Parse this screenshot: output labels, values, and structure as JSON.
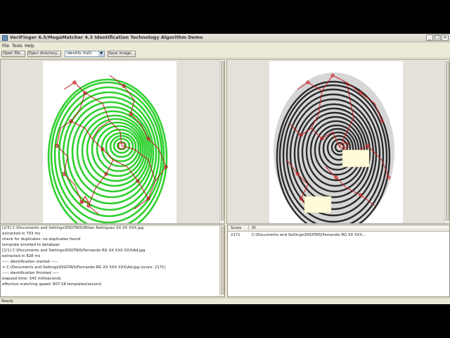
{
  "window": {
    "title": "VeriFinger 6.5/MegaMatcher 4.3 Identification Technology Algorithm Demo",
    "minimize": "_",
    "maximize": "□",
    "close": "×"
  },
  "menu": [
    "File",
    "Tools",
    "Help"
  ],
  "toolbar": {
    "open_file": "Open file...",
    "open_directory": "Open directory...",
    "mode_value": "Identify (full)",
    "save_image": "Save image..."
  },
  "log": {
    "lines": [
      "[2/5] C:\\Documents and Settings\\DIGITAIS\\Wilian Rodrigues XX XX XXX.jpg",
      "extracted in 703 ms",
      "check for duplicates: no duplicates found",
      "template enrolled to database",
      "[1/1] C:\\Documents and Settings\\DIGITAIS\\Fernando RG XX XXX XXX\\Ad.jpg",
      "extracted in 828 ms",
      "----- identification started -----",
      "> C:\\Documents and Settings\\DIGITAIS\\Fernando RG XX XXX XXX\\Ad.jpg (score: 2171)",
      "----- identification finished -----",
      "elapsed time: 343 milliseconds",
      "effective matching speed:   807.58 templates/second"
    ]
  },
  "results": {
    "col_score": "Score",
    "col_id": "ID",
    "rows": [
      {
        "score": "2171",
        "id": "C:\\Documents and Settings\\DIGITAIS\\Fernando RG XX XXX..."
      }
    ]
  },
  "status": "Ready",
  "colors": {
    "ridge_green": "#2fd02f",
    "minutia_red": "#c81e1e",
    "ink_dark": "#2a2a2a"
  }
}
